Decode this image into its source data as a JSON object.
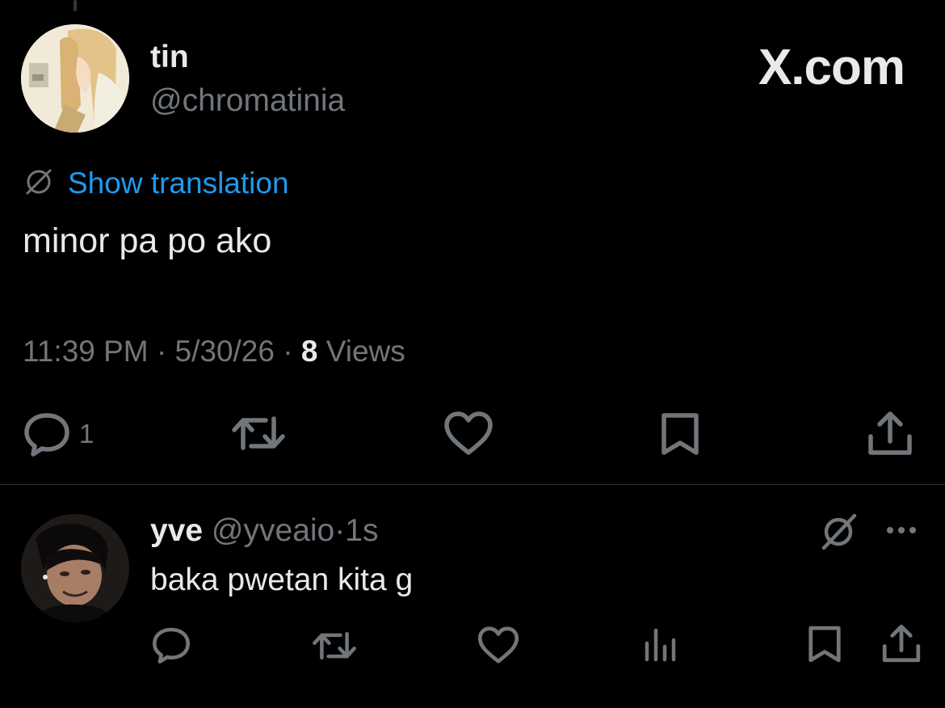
{
  "author": {
    "display_name": "tin",
    "handle": "@chromatinia",
    "avatar": "avatar-anime-girl"
  },
  "brand": {
    "label": "X.com"
  },
  "translation": {
    "icon": "translate-icon",
    "label": "Show translation"
  },
  "tweet": {
    "text": "minor pa po ako",
    "time": "11:39 PM",
    "separator": "·",
    "date": "5/30/26",
    "views_count": "8",
    "views_label": "Views"
  },
  "actions": {
    "reply_count": "1",
    "icons": [
      "reply-icon",
      "retweet-icon",
      "like-icon",
      "bookmark-icon",
      "share-icon"
    ]
  },
  "reply": {
    "display_name": "yve",
    "handle": "@yveaio",
    "separator": "·",
    "time": "1s",
    "text": "baka pwetan kita g",
    "avatar": "avatar-person-photo",
    "icons": [
      "grok-icon",
      "more-icon",
      "reply-icon",
      "retweet-icon",
      "like-icon",
      "analytics-icon",
      "bookmark-icon",
      "share-icon"
    ]
  },
  "colors": {
    "background": "#000000",
    "text": "#e7e9ea",
    "muted": "#71767b",
    "link": "#1d9bf0",
    "divider": "#2f3336"
  }
}
